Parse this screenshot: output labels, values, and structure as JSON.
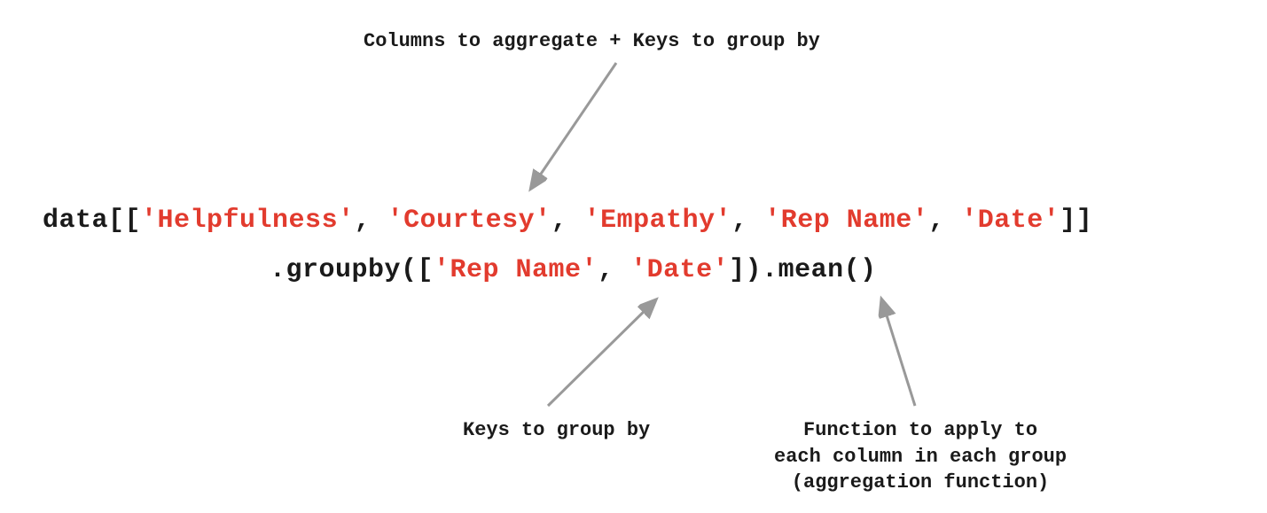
{
  "annotations": {
    "top": "Columns to aggregate + Keys to group by",
    "bottom_left": "Keys to group by",
    "bottom_right_l1": "Function to apply to",
    "bottom_right_l2": "each column in each group",
    "bottom_right_l3": "(aggregation function)"
  },
  "code": {
    "p1": "data[[",
    "s1": "'Helpfulness'",
    "c": ", ",
    "s2": "'Courtesy'",
    "s3": "'Empathy'",
    "s4": "'Rep Name'",
    "s5": "'Date'",
    "p2": "]]",
    "p3": ".groupby([",
    "p4": "]).mean()"
  }
}
